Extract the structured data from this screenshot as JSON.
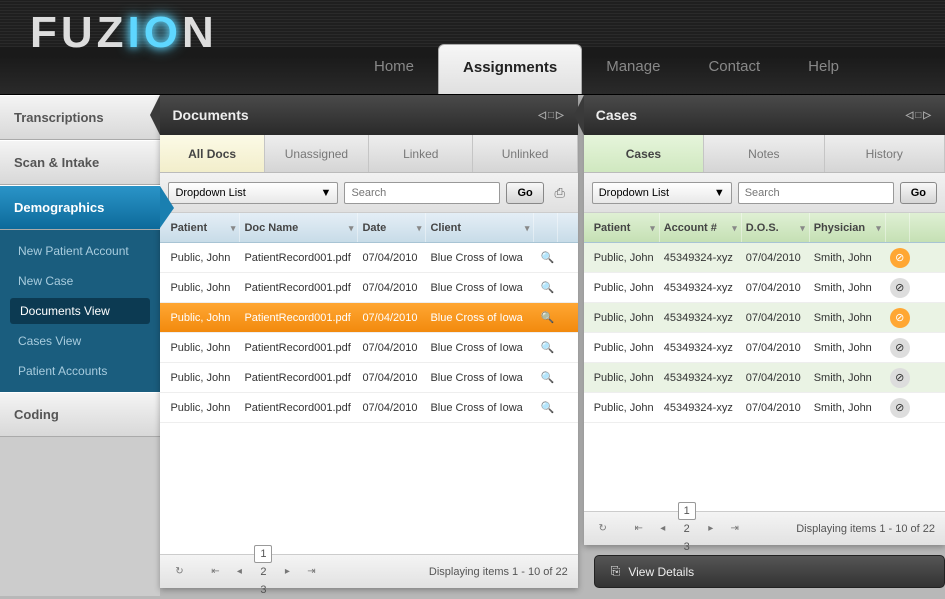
{
  "logo": {
    "part1": "FUZ",
    "part2": "IO",
    "part3": "N"
  },
  "topnav": [
    {
      "label": "Home",
      "active": false
    },
    {
      "label": "Assignments",
      "active": true
    },
    {
      "label": "Manage",
      "active": false
    },
    {
      "label": "Contact",
      "active": false
    },
    {
      "label": "Help",
      "active": false
    }
  ],
  "sidebar": {
    "sections": [
      {
        "label": "Transcriptions",
        "active": false
      },
      {
        "label": "Scan & Intake",
        "active": false
      },
      {
        "label": "Demographics",
        "active": true
      },
      {
        "label": "Coding",
        "active": false
      }
    ],
    "sub": [
      {
        "label": "New Patient Account",
        "active": false
      },
      {
        "label": "New Case",
        "active": false
      },
      {
        "label": "Documents View",
        "active": true
      },
      {
        "label": "Cases View",
        "active": false
      },
      {
        "label": "Patient Accounts",
        "active": false
      }
    ]
  },
  "documents": {
    "title": "Documents",
    "tabs": [
      "All Docs",
      "Unassigned",
      "Linked",
      "Unlinked"
    ],
    "active_tab": 0,
    "dropdown": "Dropdown List",
    "search_placeholder": "Search",
    "go": "Go",
    "columns": [
      "Patient",
      "Doc Name",
      "Date",
      "Client"
    ],
    "rows": [
      {
        "patient": "Public, John",
        "doc": "PatientRecord001.pdf",
        "date": "07/04/2010",
        "client": "Blue Cross of Iowa",
        "selected": false
      },
      {
        "patient": "Public, John",
        "doc": "PatientRecord001.pdf",
        "date": "07/04/2010",
        "client": "Blue Cross of Iowa",
        "selected": false
      },
      {
        "patient": "Public, John",
        "doc": "PatientRecord001.pdf",
        "date": "07/04/2010",
        "client": "Blue Cross of Iowa",
        "selected": true
      },
      {
        "patient": "Public, John",
        "doc": "PatientRecord001.pdf",
        "date": "07/04/2010",
        "client": "Blue Cross of Iowa",
        "selected": false
      },
      {
        "patient": "Public, John",
        "doc": "PatientRecord001.pdf",
        "date": "07/04/2010",
        "client": "Blue Cross of Iowa",
        "selected": false
      },
      {
        "patient": "Public, John",
        "doc": "PatientRecord001.pdf",
        "date": "07/04/2010",
        "client": "Blue Cross of Iowa",
        "selected": false
      }
    ],
    "pager": {
      "pages": [
        "1",
        "2",
        "3"
      ],
      "active": 0,
      "status": "Displaying items 1 - 10 of 22"
    }
  },
  "cases": {
    "title": "Cases",
    "tabs": [
      "Cases",
      "Notes",
      "History"
    ],
    "active_tab": 0,
    "dropdown": "Dropdown List",
    "search_placeholder": "Search",
    "go": "Go",
    "columns": [
      "Patient",
      "Account #",
      "D.O.S.",
      "Physician"
    ],
    "rows": [
      {
        "patient": "Public, John",
        "acct": "45349324-xyz",
        "dos": "07/04/2010",
        "phys": "Smith, John",
        "linked": true
      },
      {
        "patient": "Public, John",
        "acct": "45349324-xyz",
        "dos": "07/04/2010",
        "phys": "Smith, John",
        "linked": false
      },
      {
        "patient": "Public, John",
        "acct": "45349324-xyz",
        "dos": "07/04/2010",
        "phys": "Smith, John",
        "linked": true
      },
      {
        "patient": "Public, John",
        "acct": "45349324-xyz",
        "dos": "07/04/2010",
        "phys": "Smith, John",
        "linked": false
      },
      {
        "patient": "Public, John",
        "acct": "45349324-xyz",
        "dos": "07/04/2010",
        "phys": "Smith, John",
        "linked": false
      },
      {
        "patient": "Public, John",
        "acct": "45349324-xyz",
        "dos": "07/04/2010",
        "phys": "Smith, John",
        "linked": false
      }
    ],
    "pager": {
      "pages": [
        "1",
        "2",
        "3"
      ],
      "active": 0,
      "status": "Displaying items 1 - 10 of 22"
    }
  },
  "view_details": "View Details"
}
